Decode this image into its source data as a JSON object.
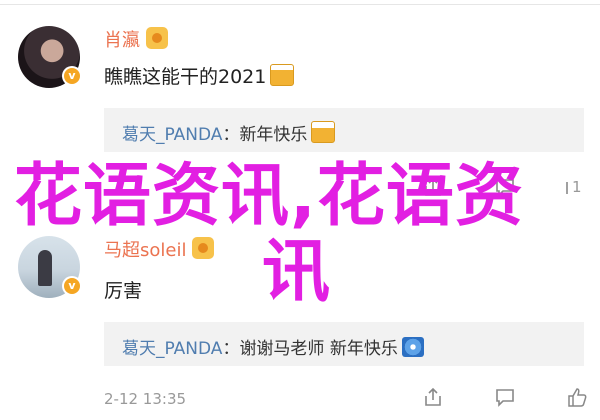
{
  "comments": [
    {
      "username": "肖瀛",
      "text": "瞧瞧这能干的2021",
      "text_emoji": "beer-mug-icon",
      "reply": {
        "name": "葛天_PANDA",
        "separator": "：",
        "text": "新年快乐",
        "emoji": "cheers-icon"
      }
    },
    {
      "username": "马超soleil",
      "text": "厉害",
      "reply": {
        "name": "葛天_PANDA",
        "separator": "：",
        "text": "谢谢马老师 新年快乐",
        "emoji": "fireworks-icon"
      },
      "timestamp": "2-12 13:35"
    }
  ],
  "like_count_first": "1",
  "watermark": {
    "line1": "花语资讯,花语资",
    "line2": "讯",
    "color": "#e21fe2"
  },
  "colors": {
    "username": "#eb7350",
    "reply_name": "#507daf",
    "reply_bg": "#f2f2f2",
    "meta": "#999999"
  }
}
